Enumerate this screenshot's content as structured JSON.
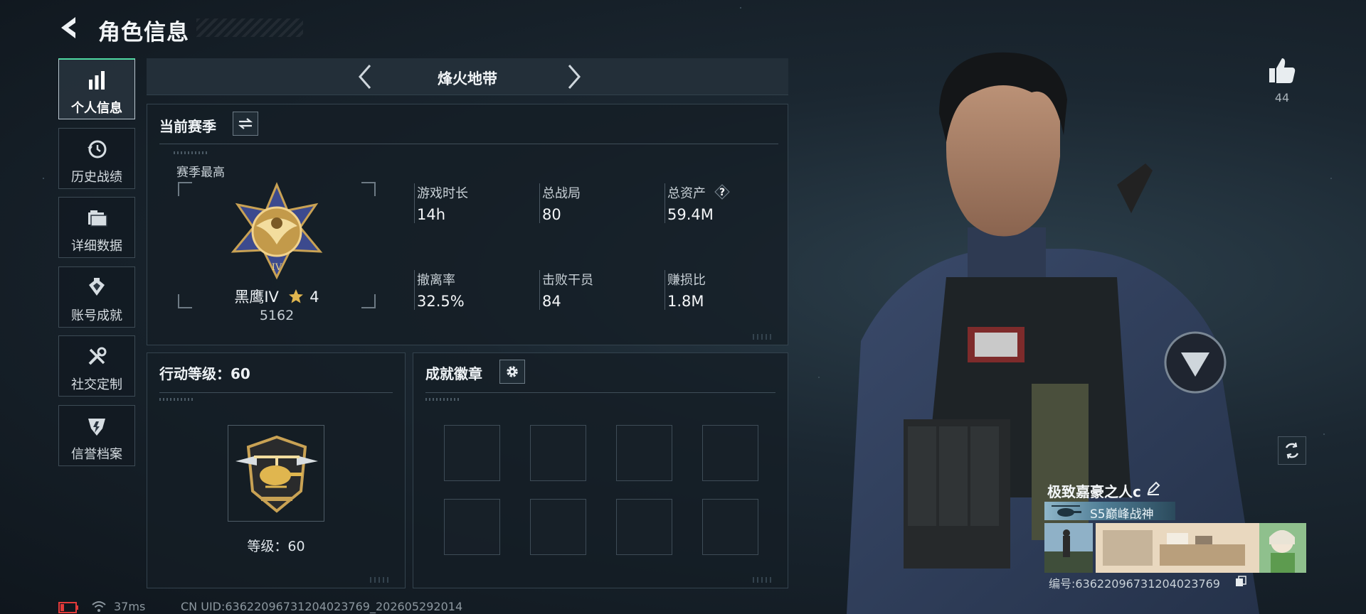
{
  "header": {
    "title": "角色信息",
    "back_icon": "back-arrow-icon"
  },
  "sidebar": {
    "items": [
      {
        "label": "个人信息",
        "icon": "bar-chart-icon",
        "active": true
      },
      {
        "label": "历史战绩",
        "icon": "history-clock-icon",
        "active": false
      },
      {
        "label": "详细数据",
        "icon": "folder-icon",
        "active": false
      },
      {
        "label": "账号成就",
        "icon": "medal-icon",
        "active": false
      },
      {
        "label": "社交定制",
        "icon": "tools-icon",
        "active": false
      },
      {
        "label": "信誉档案",
        "icon": "reputation-icon",
        "active": false
      }
    ]
  },
  "mode": {
    "title": "烽火地带"
  },
  "season": {
    "title": "当前赛季",
    "best_label": "赛季最高",
    "rank_name": "黑鹰IV",
    "rank_stars": "4",
    "rank_points": "5162",
    "stats": [
      {
        "label": "游戏时长",
        "value": "14h"
      },
      {
        "label": "总战局",
        "value": "80"
      },
      {
        "label": "总资产",
        "value": "59.4M",
        "help": "?"
      },
      {
        "label": "撤离率",
        "value": "32.5%"
      },
      {
        "label": "击败干员",
        "value": "84"
      },
      {
        "label": "赚损比",
        "value": "1.8M"
      }
    ]
  },
  "level": {
    "title": "行动等级：60",
    "level_text": "等级：60"
  },
  "achievements": {
    "title": "成就徽章",
    "slot_count": 8
  },
  "status": {
    "ping": "37ms",
    "uid": "CN UID:63622096731204023769_202605292014"
  },
  "likes": {
    "count": "44"
  },
  "player": {
    "name": "极致嘉豪之人c",
    "title_badge": "S5巅峰战神",
    "id_text": "编号:63622096731204023769"
  },
  "colors": {
    "accent_green": "#4fd9a2",
    "panel_border": "#34434e",
    "background": "#1b2731"
  }
}
